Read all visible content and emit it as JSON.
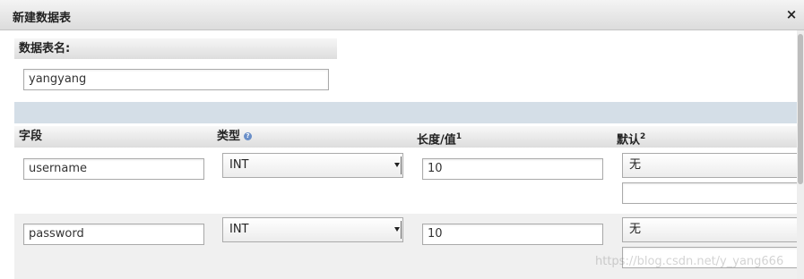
{
  "dialog": {
    "title": "新建数据表",
    "close_icon": "×"
  },
  "table_name": {
    "label": "数据表名:",
    "value": "yangyang"
  },
  "columns": {
    "field": "字段",
    "type": "类型",
    "length": "长度/值",
    "length_sup": "1",
    "default": "默认",
    "default_sup": "2"
  },
  "rows": [
    {
      "field": "username",
      "type": "INT",
      "length": "10",
      "default": "无",
      "default_value": ""
    },
    {
      "field": "password",
      "type": "INT",
      "length": "10",
      "default": "无",
      "default_value": ""
    }
  ],
  "watermark": "https://blog.csdn.net/y_yang666"
}
